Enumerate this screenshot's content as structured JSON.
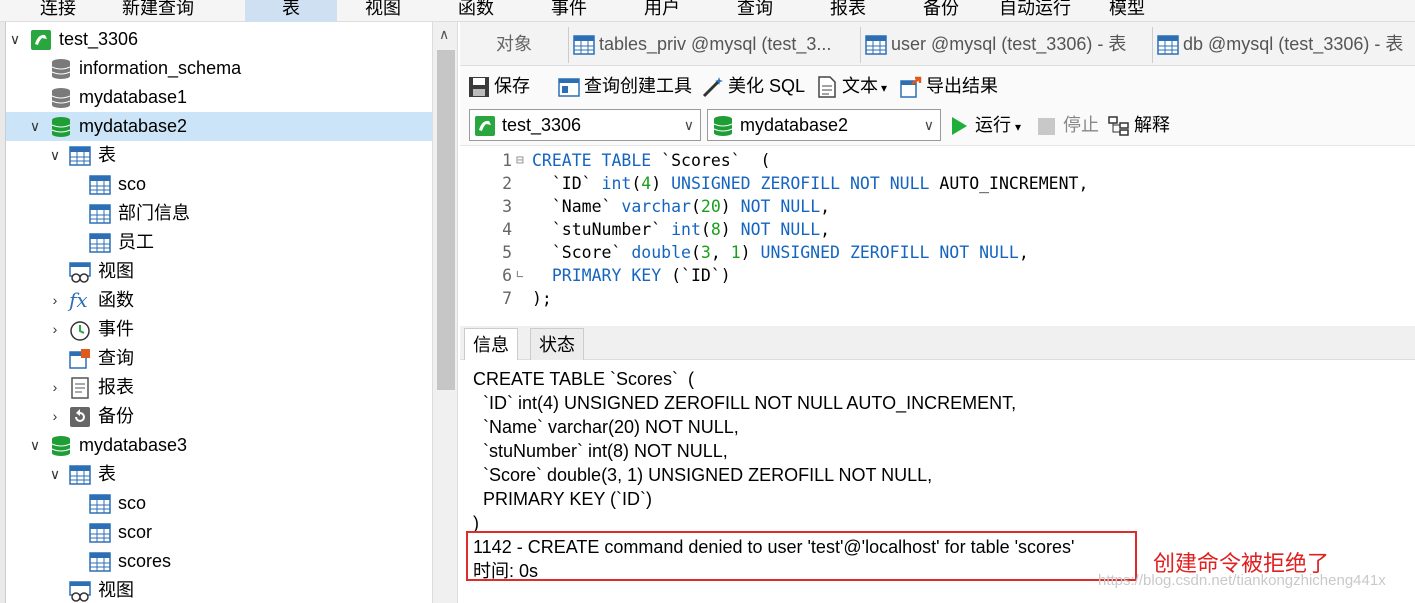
{
  "menu": [
    "连接",
    "新建查询",
    "表",
    "视图",
    "函数",
    "事件",
    "用户",
    "查询",
    "报表",
    "备份",
    "自动运行",
    "模型"
  ],
  "tree": {
    "items": [
      {
        "label": "test_3306",
        "icon": "mysql-connection-icon"
      },
      {
        "label": "information_schema",
        "icon": "database-icon"
      },
      {
        "label": "mydatabase1",
        "icon": "database-icon"
      },
      {
        "label": "mydatabase2",
        "icon": "database-open-icon"
      },
      {
        "label": "表",
        "icon": "tables-icon"
      },
      {
        "label": "sco",
        "icon": "table-icon"
      },
      {
        "label": "部门信息",
        "icon": "table-icon"
      },
      {
        "label": "员工",
        "icon": "table-icon"
      },
      {
        "label": "视图",
        "icon": "views-icon"
      },
      {
        "label": "函数",
        "icon": "function-icon"
      },
      {
        "label": "事件",
        "icon": "event-icon"
      },
      {
        "label": "查询",
        "icon": "query-icon"
      },
      {
        "label": "报表",
        "icon": "report-icon"
      },
      {
        "label": "备份",
        "icon": "backup-icon"
      },
      {
        "label": "mydatabase3",
        "icon": "database-open-icon"
      },
      {
        "label": "表",
        "icon": "tables-icon"
      },
      {
        "label": "sco",
        "icon": "table-icon"
      },
      {
        "label": "scor",
        "icon": "table-icon"
      },
      {
        "label": "scores",
        "icon": "table-icon"
      },
      {
        "label": "视图",
        "icon": "views-icon"
      }
    ]
  },
  "tabs": {
    "objects": "对象",
    "tab1": "tables_priv @mysql (test_3...",
    "tab2": "user @mysql (test_3306) - 表",
    "tab3": "db @mysql (test_3306) - 表"
  },
  "toolbar": {
    "save": "保存",
    "query_builder": "查询创建工具",
    "beautify": "美化 SQL",
    "text": "文本",
    "export": "导出结果",
    "connection": "test_3306",
    "database": "mydatabase2",
    "run": "运行",
    "stop": "停止",
    "explain": "解释"
  },
  "editor": {
    "line_numbers": [
      "1",
      "2",
      "3",
      "4",
      "5",
      "6",
      "7"
    ]
  },
  "output": {
    "tab_info": "信息",
    "tab_status": "状态",
    "lines": [
      "CREATE TABLE `Scores`  (",
      "  `ID` int(4) UNSIGNED ZEROFILL NOT NULL AUTO_INCREMENT,",
      "  `Name` varchar(20) NOT NULL,",
      "  `stuNumber` int(8) NOT NULL,",
      "  `Score` double(3, 1) UNSIGNED ZEROFILL NOT NULL,",
      "  PRIMARY KEY (`ID`)",
      ")"
    ],
    "error": "1142 - CREATE command denied to user 'test'@'localhost' for table 'scores'",
    "time": "时间: 0s"
  },
  "annotation": "创建命令被拒绝了",
  "watermark": "https://blog.csdn.net/tiankongzhicheng441x",
  "colors": {
    "accent": "#cce4f7",
    "error_border": "#e02b2b",
    "keyword": "#1565c0",
    "number": "#1b9e1b"
  }
}
